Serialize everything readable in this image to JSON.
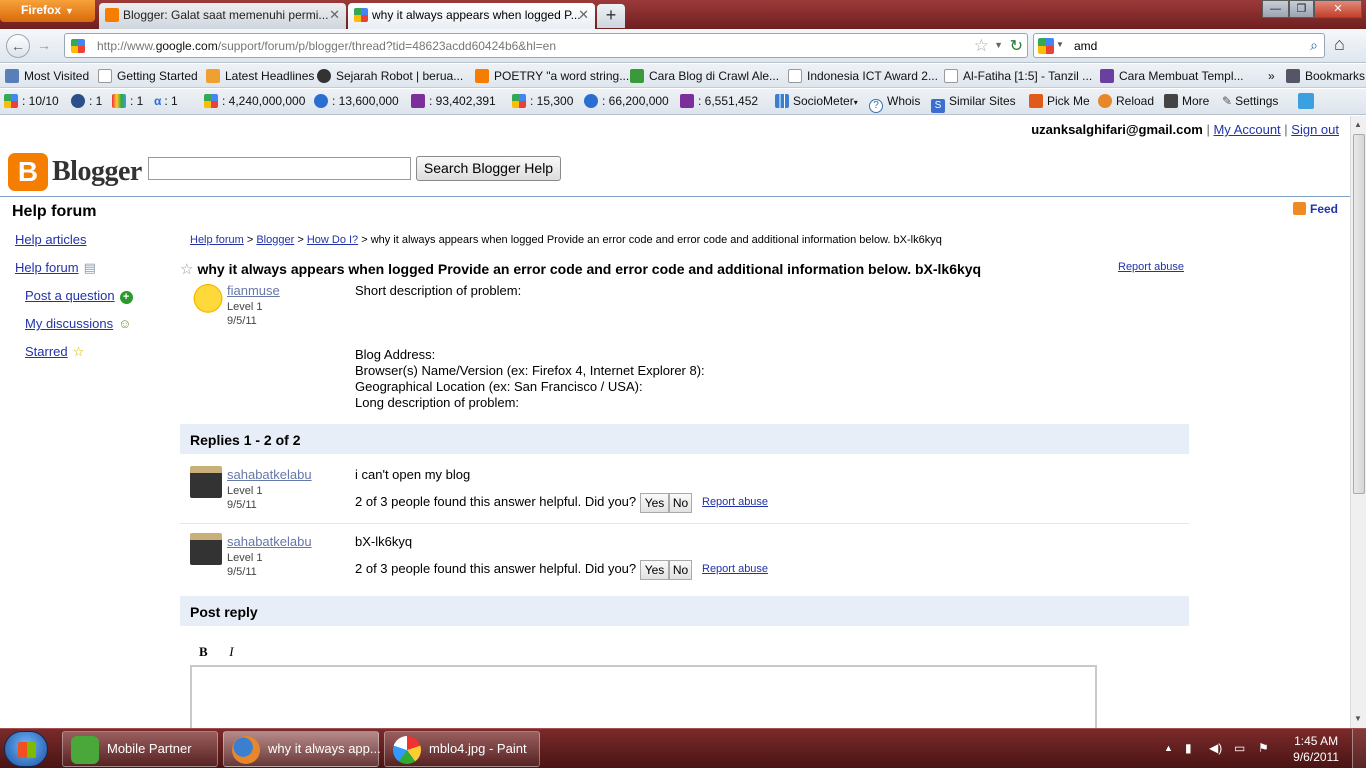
{
  "browser": {
    "menu_button": "Firefox",
    "tabs": [
      {
        "label": "Blogger: Galat saat memenuhi permi...",
        "active": false
      },
      {
        "label": "why it always appears when logged P...",
        "active": true
      }
    ],
    "url_prefix": "http://www.",
    "url_domain": "google.com",
    "url_rest": "/support/forum/p/blogger/thread?tid=48623acdd60424b6&hl=en",
    "search_query": "amd",
    "bookmarks": [
      "Most Visited",
      "Getting Started",
      "Latest Headlines",
      "Sejarah Robot | berua...",
      "POETRY \"a word string...",
      "Cara Blog di Crawl Ale...",
      "Indonesia ICT Award 2...",
      "Al-Fatiha [1:5] - Tanzil ...",
      "Cara Membuat Templ...",
      "Bookmarks"
    ],
    "addon_bar": {
      "pagerank": ": 10/10",
      "alexa": ": 1",
      "compete": ": 1",
      "quantcast": ": 1",
      "google_index": ": 4,240,000,000",
      "bing_index": ": 13,600,000",
      "yahoo_index": ": 93,402,391",
      "google_links": ": 15,300",
      "bing_links": ": 66,200,000",
      "yahoo_links": ": 6,551,452",
      "items": [
        "SocioMeter",
        "Whois",
        "Similar Sites",
        "Pick Me",
        "Reload",
        "More",
        "Settings"
      ]
    }
  },
  "account": {
    "email": "uzanksalghifari@gmail.com",
    "my_account": "My Account",
    "sign_out": "Sign out"
  },
  "header": {
    "logo_letter": "B",
    "logo_text": "Blogger",
    "search_button": "Search Blogger Help",
    "forum_title": "Help forum",
    "feed": "Feed"
  },
  "leftnav": {
    "help_articles": "Help articles",
    "help_forum": "Help forum",
    "post_question": "Post a question",
    "my_discussions": "My discussions",
    "starred": "Starred"
  },
  "breadcrumb": {
    "items": [
      "Help forum",
      "Blogger",
      "How Do I?"
    ],
    "current": "why it always appears when logged Provide an error code and error code and additional information below. bX-lk6kyq"
  },
  "thread": {
    "title": "why it always appears when logged Provide an error code and error code and additional information below. bX-lk6kyq",
    "report_abuse": "Report abuse",
    "author": "fianmuse",
    "level": "Level 1",
    "date": "9/5/11",
    "lines": [
      "Short description of problem:",
      "",
      "",
      "",
      "Blog Address:",
      "Browser(s) Name/Version (ex: Firefox 4, Internet Explorer 8):",
      "Geographical Location (ex: San Francisco / USA):",
      "Long description of problem:"
    ]
  },
  "replies": {
    "heading": "Replies 1 - 2 of 2",
    "items": [
      {
        "author": "sahabatkelabu",
        "level": "Level 1",
        "date": "9/5/11",
        "text": "i can't open my blog",
        "helpful": "2 of 3 people found this answer helpful. Did you?",
        "yes": "Yes",
        "no": "No",
        "report": "Report abuse"
      },
      {
        "author": "sahabatkelabu",
        "level": "Level 1",
        "date": "9/5/11",
        "text": "bX-lk6kyq",
        "helpful": "2 of 3 people found this answer helpful. Did you?",
        "yes": "Yes",
        "no": "No",
        "report": "Report abuse"
      }
    ]
  },
  "post_reply": {
    "heading": "Post reply",
    "bold": "B",
    "italic": "I"
  },
  "taskbar": {
    "tasks": [
      "Mobile Partner",
      "why it always app...",
      "mblo4.jpg - Paint"
    ],
    "time": "1:45 AM",
    "date": "9/6/2011"
  },
  "colors": {
    "titlebar": "#8a2e2e",
    "blogger_orange": "#f57d00",
    "link": "#2233aa",
    "section_bg": "#e8eef7"
  }
}
